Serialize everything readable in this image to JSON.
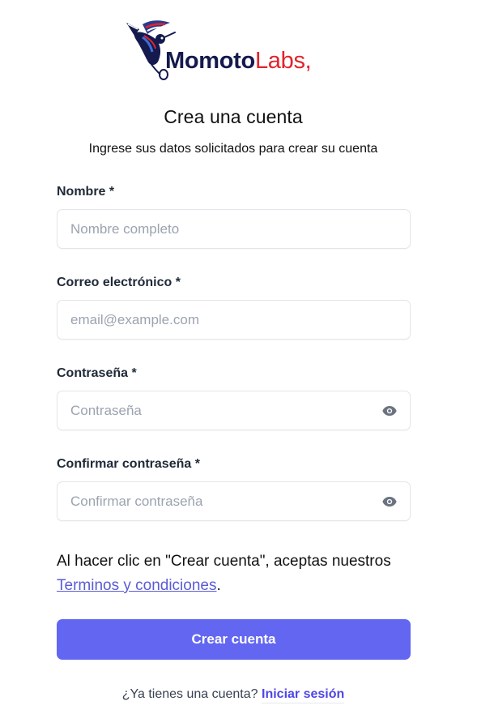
{
  "brand": {
    "name_dark": "Momoto",
    "name_red": "Labs,",
    "colors": {
      "dark": "#141a4d",
      "red": "#e2232a",
      "accent": "#6366f1"
    },
    "logo_icon": "hummingbird-icon"
  },
  "header": {
    "title": "Crea una cuenta",
    "subtitle": "Ingrese sus datos solicitados para crear su cuenta"
  },
  "form": {
    "name": {
      "label": "Nombre *",
      "placeholder": "Nombre completo",
      "value": ""
    },
    "email": {
      "label": "Correo electrónico *",
      "placeholder": "email@example.com",
      "value": ""
    },
    "password": {
      "label": "Contraseña *",
      "placeholder": "Contraseña",
      "value": "",
      "toggle_icon": "eye-icon"
    },
    "confirm_password": {
      "label": "Confirmar contraseña *",
      "placeholder": "Confirmar contraseña",
      "value": "",
      "toggle_icon": "eye-icon"
    }
  },
  "terms": {
    "prefix": "Al hacer clic en \"Crear cuenta\", aceptas nuestros",
    "link": "Terminos y condiciones",
    "suffix": "."
  },
  "submit_label": "Crear cuenta",
  "footer": {
    "question": "¿Ya tienes una cuenta?",
    "link": "Iniciar sesión"
  }
}
